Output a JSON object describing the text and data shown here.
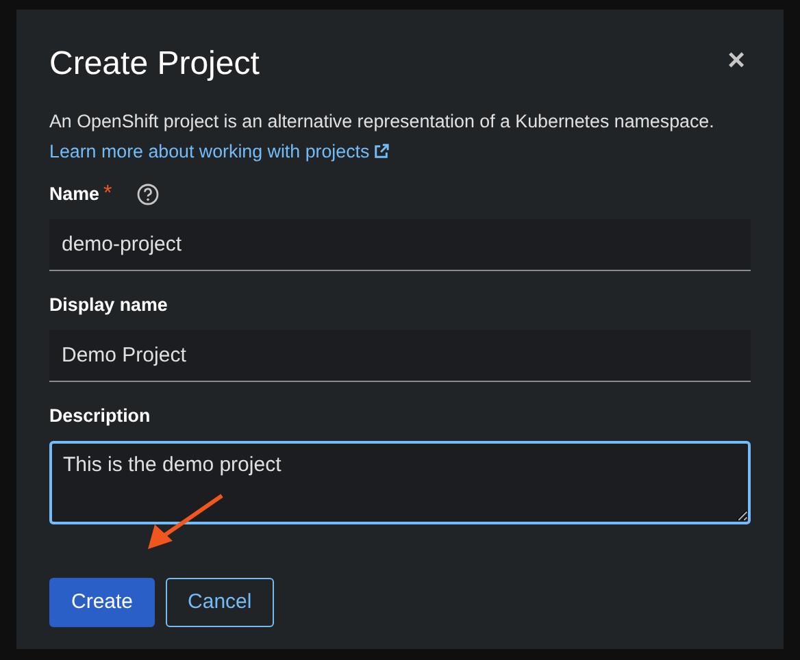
{
  "dialog": {
    "title": "Create Project",
    "close": "×",
    "description": "An OpenShift project is an alternative representation of a Kubernetes namespace.",
    "link": {
      "label": "Learn more about working with projects",
      "external": true
    }
  },
  "fields": [
    {
      "kind": "input",
      "label": "Name",
      "required_mark": "*",
      "help": true,
      "value": "demo-project",
      "focused": false
    },
    {
      "kind": "input",
      "label": "Display name",
      "value": "Demo Project",
      "focused": false
    },
    {
      "kind": "textarea",
      "label": "Description",
      "value": "This is the demo project",
      "focused": true
    }
  ],
  "buttons": [
    {
      "label": "Create",
      "kind": "primary"
    },
    {
      "label": "Cancel",
      "kind": "secondary"
    }
  ]
}
